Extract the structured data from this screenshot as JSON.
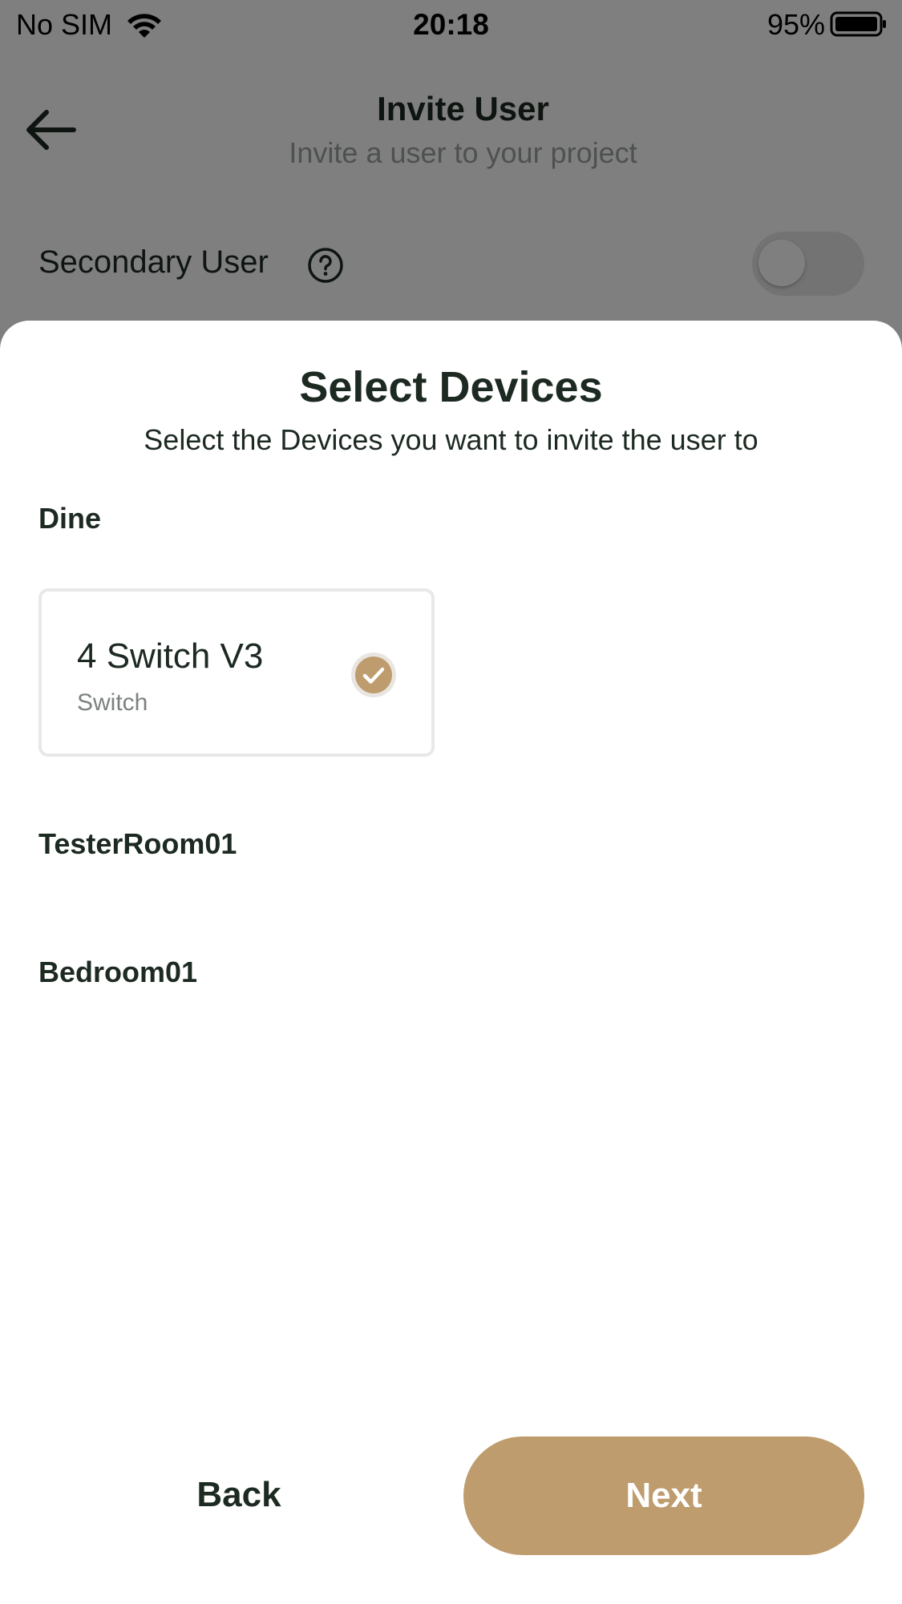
{
  "status_bar": {
    "carrier": "No SIM",
    "time": "20:18",
    "battery_percent": "95%",
    "icons": [
      "wifi-icon",
      "battery-icon"
    ]
  },
  "header": {
    "back_icon": "arrow-left-icon",
    "title": "Invite User",
    "subtitle": "Invite a user to your project"
  },
  "secondary_user": {
    "label": "Secondary User",
    "help_icon": "question-circle-icon",
    "toggle_on": false
  },
  "sheet": {
    "title": "Select Devices",
    "subtitle": "Select the Devices you want to invite the user to",
    "rooms": [
      {
        "name": "Dine",
        "devices": [
          {
            "name": "4 Switch V3",
            "type": "Switch",
            "selected": true
          }
        ]
      },
      {
        "name": "TesterRoom01",
        "devices": []
      },
      {
        "name": "Bedroom01",
        "devices": []
      }
    ],
    "back_label": "Back",
    "next_label": "Next"
  },
  "colors": {
    "accent": "#be9c6d",
    "text_dark": "#1d2a22",
    "text_muted": "#7b827e",
    "overlay": "rgba(0,0,0,0.5)"
  }
}
